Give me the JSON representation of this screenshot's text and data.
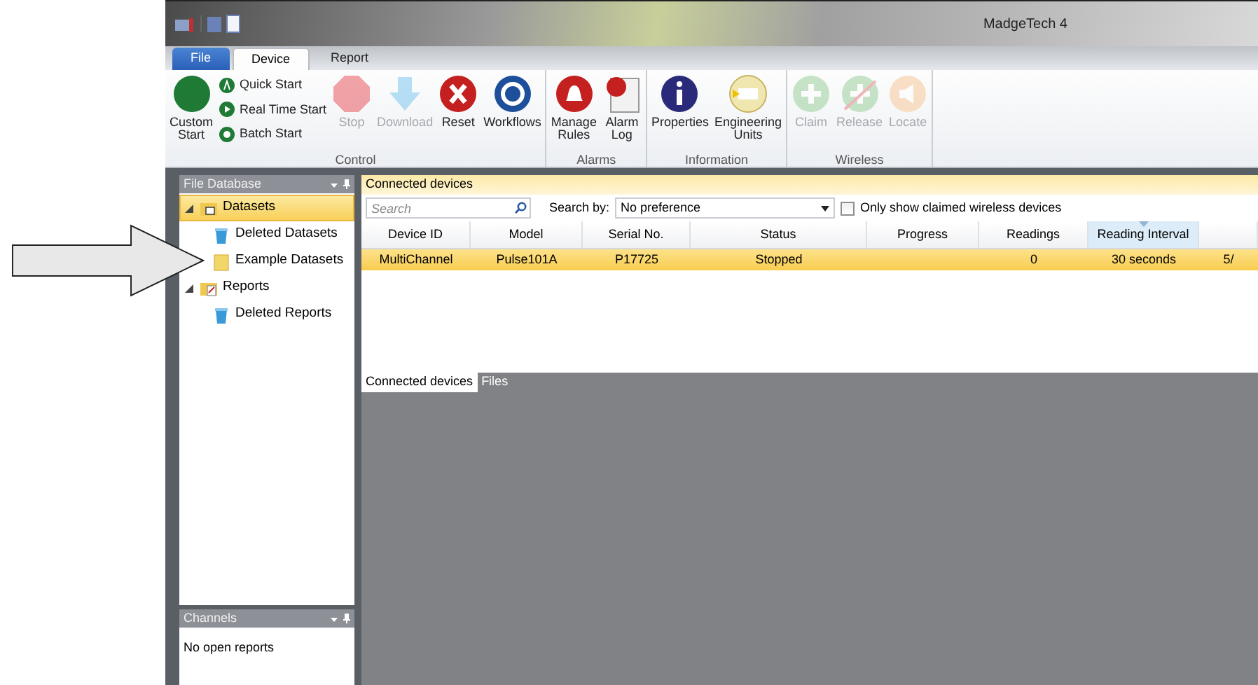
{
  "window": {
    "title": "MadgeTech 4"
  },
  "ribbon_tabs": [
    {
      "label": "File",
      "kind": "file",
      "selected": false
    },
    {
      "label": "Device",
      "kind": "tab",
      "selected": true
    },
    {
      "label": "Report",
      "kind": "tab",
      "selected": false
    }
  ],
  "ribbon_groups": [
    {
      "label": "Control",
      "items": [
        {
          "kind": "large",
          "label": "Custom Start",
          "disabled": false
        },
        {
          "kind": "small",
          "label": "Quick Start",
          "disabled": false
        },
        {
          "kind": "small",
          "label": "Real Time Start",
          "disabled": false
        },
        {
          "kind": "small",
          "label": "Batch Start",
          "disabled": false
        },
        {
          "kind": "large",
          "label": "Stop",
          "disabled": true
        },
        {
          "kind": "large",
          "label": "Download",
          "disabled": true
        },
        {
          "kind": "large",
          "label": "Reset",
          "disabled": false
        },
        {
          "kind": "large",
          "label": "Workflows",
          "disabled": false
        }
      ]
    },
    {
      "label": "Alarms",
      "items": [
        {
          "kind": "large",
          "label": "Manage Rules",
          "disabled": false
        },
        {
          "kind": "large",
          "label": "Alarm Log",
          "disabled": false
        }
      ]
    },
    {
      "label": "Information",
      "items": [
        {
          "kind": "large",
          "label": "Properties",
          "disabled": false
        },
        {
          "kind": "large",
          "label": "Engineering Units",
          "disabled": false
        }
      ]
    },
    {
      "label": "Wireless",
      "items": [
        {
          "kind": "large",
          "label": "Claim",
          "disabled": true
        },
        {
          "kind": "large",
          "label": "Release",
          "disabled": true
        },
        {
          "kind": "large",
          "label": "Locate",
          "disabled": true
        }
      ]
    }
  ],
  "file_database": {
    "title": "File Database",
    "tree": [
      {
        "label": "Datasets",
        "kind": "folder",
        "selected": true,
        "expanded": true,
        "children": [
          {
            "label": "Deleted Datasets",
            "kind": "trash",
            "selected": false
          },
          {
            "label": "Example Datasets",
            "kind": "plain-folder",
            "selected": false
          }
        ]
      },
      {
        "label": "Reports",
        "kind": "report-folder",
        "selected": false,
        "expanded": true,
        "children": [
          {
            "label": "Deleted Reports",
            "kind": "trash",
            "selected": false
          }
        ]
      }
    ]
  },
  "channels": {
    "title": "Channels",
    "message": "No open reports"
  },
  "connected_devices": {
    "title": "Connected devices",
    "search": {
      "placeholder": "Search"
    },
    "search_by": {
      "label": "Search by:",
      "value": "No preference"
    },
    "claimed_only": {
      "label": "Only show claimed wireless devices",
      "checked": false
    },
    "table": {
      "columns": [
        {
          "label": "Device ID",
          "sorted": false
        },
        {
          "label": "Model",
          "sorted": false
        },
        {
          "label": "Serial No.",
          "sorted": false
        },
        {
          "label": "Status",
          "sorted": false
        },
        {
          "label": "Progress",
          "sorted": false
        },
        {
          "label": "Readings",
          "sorted": false
        },
        {
          "label": "Reading Interval",
          "sorted": true
        },
        {
          "sorted": false
        }
      ],
      "rows": [
        {
          "selected": true,
          "cells": [
            "MultiChannel",
            "Pulse101A",
            "P17725",
            "Stopped",
            "",
            "0",
            "30 seconds",
            "5/"
          ]
        }
      ]
    }
  },
  "bottom_tabs": [
    {
      "label": "Connected devices",
      "selected": true
    },
    {
      "label": "Files",
      "selected": false
    }
  ]
}
